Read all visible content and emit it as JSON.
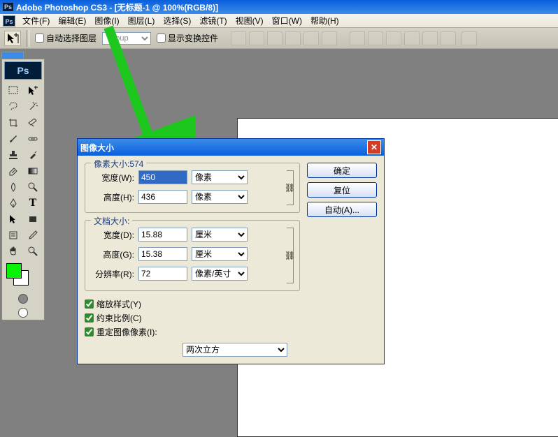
{
  "title": "Adobe Photoshop CS3 - [无标题-1 @ 100%(RGB/8)]",
  "menu": {
    "items": [
      "文件(F)",
      "编辑(E)",
      "图像(I)",
      "图层(L)",
      "选择(S)",
      "滤镜(T)",
      "视图(V)",
      "窗口(W)",
      "帮助(H)"
    ]
  },
  "options": {
    "auto_select": "自动选择图层",
    "group_dd": "Group",
    "show_transform": "显示变换控件"
  },
  "dialog": {
    "title": "图像大小",
    "pixel_legend": "像素大小:574",
    "width_lbl": "宽度(W):",
    "width_val": "450",
    "width_unit": "像素",
    "height_lbl": "高度(H):",
    "height_val": "436",
    "height_unit": "像素",
    "doc_legend": "文档大小:",
    "doc_width_lbl": "宽度(D):",
    "doc_width_val": "15.88",
    "doc_width_unit": "厘米",
    "doc_height_lbl": "高度(G):",
    "doc_height_val": "15.38",
    "doc_height_unit": "厘米",
    "res_lbl": "分辨率(R):",
    "res_val": "72",
    "res_unit": "像素/英寸",
    "cb1": "缩放样式(Y)",
    "cb2": "约束比例(C)",
    "cb3": "重定图像像素(I):",
    "resample": "两次立方",
    "ok": "确定",
    "reset": "复位",
    "auto": "自动(A)..."
  }
}
